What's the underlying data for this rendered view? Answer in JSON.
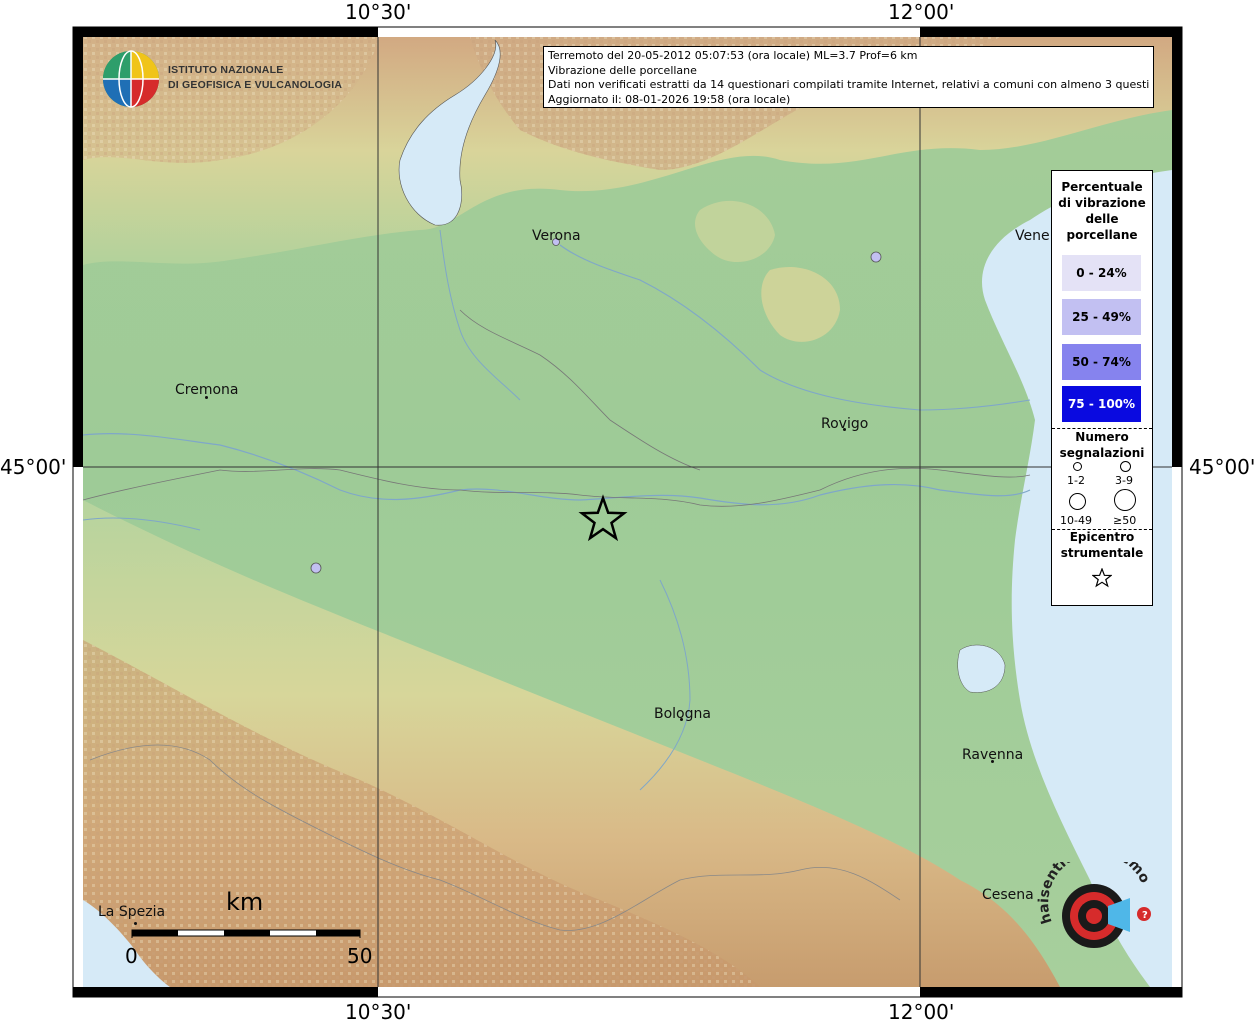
{
  "map": {
    "axis_labels": {
      "top_left": "10°30'",
      "top_right": "12°00'",
      "bottom_left": "10°30'",
      "bottom_right": "12°00'",
      "left": "45°00'",
      "right": "45°00'"
    },
    "info": {
      "line1": "Terremoto del 20-05-2012 05:07:53 (ora locale) ML=3.7 Prof=6 km",
      "line2": "Vibrazione delle porcellane",
      "line3": "Dati non verificati estratti da 14 questionari compilati tramite Internet, relativi a comuni con almeno 3 questionari.",
      "line4": "Aggiornato il: 08-01-2026 19:58 (ora locale)"
    },
    "logo": {
      "line1": "ISTITUTO NAZIONALE",
      "line2": "DI GEOFISICA E VULCANOLOGIA"
    },
    "cities": {
      "verona": "Verona",
      "venezia": "Vene",
      "cremona": "Cremona",
      "rovigo": "Rovigo",
      "bologna": "Bologna",
      "ravenna": "Ravenna",
      "cesena": "Cesena",
      "la_spezia": "La Spezia"
    },
    "scale": {
      "unit": "km",
      "start": "0",
      "end": "50"
    },
    "legend": {
      "title_lines": [
        "Percentuale",
        "di vibrazione",
        "delle",
        "porcellane"
      ],
      "classes": [
        {
          "label": "0 - 24%",
          "color": "#e4e2f6"
        },
        {
          "label": "25 - 49%",
          "color": "#c2c0f2"
        },
        {
          "label": "50 - 74%",
          "color": "#8683ee"
        },
        {
          "label": "75 - 100%",
          "color": "#0a0ae0"
        }
      ],
      "count_title_lines": [
        "Numero",
        "segnalazioni"
      ],
      "counts": [
        "1-2",
        "3-9",
        "10-49",
        "≥50"
      ],
      "epicenter_lines": [
        "Epicentro",
        "strumentale"
      ]
    },
    "hai_logo": "haisentitoilterremoto.it",
    "colors": {
      "plain": "#9cc898",
      "sea": "#d6eaf7",
      "obs_dot": "#c2c0f2"
    }
  }
}
